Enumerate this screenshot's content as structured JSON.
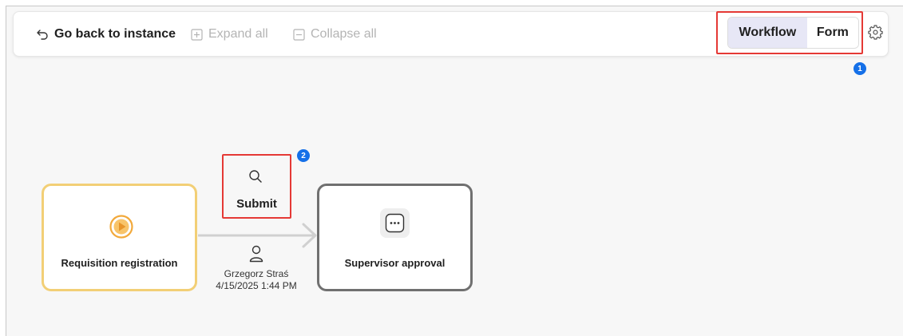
{
  "toolbar": {
    "back_label": "Go back to instance",
    "expand_label": "Expand all",
    "collapse_label": "Collapse all"
  },
  "view_toggle": {
    "options": [
      "Workflow",
      "Form"
    ],
    "selected": "Workflow"
  },
  "annotations": {
    "badge_1": "1",
    "badge_2": "2"
  },
  "workflow": {
    "start_step": {
      "label": "Requisition registration",
      "icon": "play-icon"
    },
    "transition": {
      "label": "Submit",
      "icon": "search-icon",
      "user": "Grzegorz Straś",
      "timestamp": "4/15/2025 1:44 PM"
    },
    "current_step": {
      "label": "Supervisor approval",
      "icon": "more-dots-icon"
    }
  },
  "colors": {
    "start_border": "#f2cf76",
    "play_accent": "#f2a93b",
    "step_border": "#707070",
    "highlight": "#e53935",
    "badge": "#1570e8",
    "selected_segment": "#e7e7f6"
  }
}
